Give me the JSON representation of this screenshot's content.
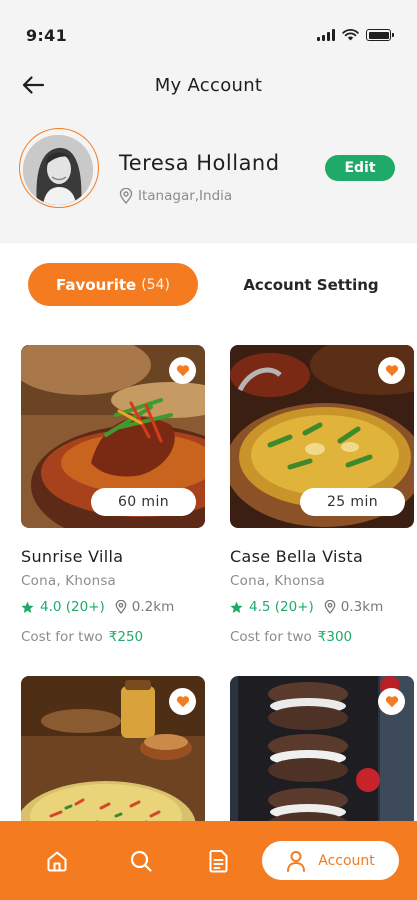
{
  "status": {
    "time": "9:41"
  },
  "header": {
    "title": "My Account",
    "back_icon": "arrow-left-icon"
  },
  "profile": {
    "name": "Teresa Holland",
    "location": "Itanagar,India",
    "edit_label": "Edit"
  },
  "tabs": {
    "favourite_label": "Favourite",
    "favourite_count": "(54)",
    "settings_label": "Account Setting"
  },
  "restaurants": [
    {
      "name": "Sunrise Villa",
      "area": "Cona, Khonsa",
      "time": "60 min",
      "rating": "4.0 (20+)",
      "distance": "0.2km",
      "cost_label": "Cost for two",
      "price": "₹250"
    },
    {
      "name": "Case Bella Vista",
      "area": "Cona, Khonsa",
      "time": "25 min",
      "rating": "4.5 (20+)",
      "distance": "0.3km",
      "cost_label": "Cost for two",
      "price": "₹300"
    }
  ],
  "bottom_nav": {
    "items": [
      "home-icon",
      "search-icon",
      "orders-icon",
      "account-icon"
    ],
    "active_label": "Account"
  },
  "colors": {
    "accent": "#f47b20",
    "green": "#1faa6a",
    "text": "#1f1f1f",
    "muted": "#8c8c8c"
  }
}
